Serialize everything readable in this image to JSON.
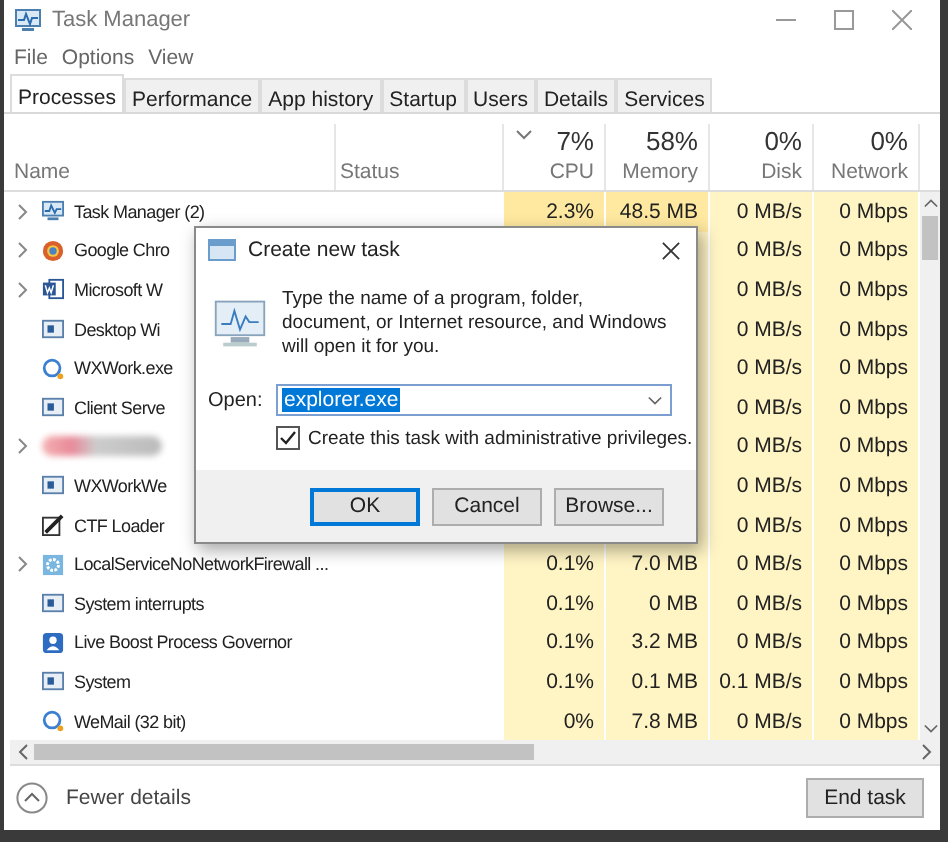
{
  "window": {
    "title": "Task Manager"
  },
  "menu": [
    "File",
    "Options",
    "View"
  ],
  "tabs": [
    {
      "label": "Processes",
      "selected": true
    },
    {
      "label": "Performance",
      "selected": false
    },
    {
      "label": "App history",
      "selected": false
    },
    {
      "label": "Startup",
      "selected": false
    },
    {
      "label": "Users",
      "selected": false
    },
    {
      "label": "Details",
      "selected": false
    },
    {
      "label": "Services",
      "selected": false
    }
  ],
  "columns": [
    {
      "label": "Name",
      "sorted": false
    },
    {
      "label": "Status",
      "sorted": false
    },
    {
      "label": "CPU",
      "total": "7%",
      "sorted": true
    },
    {
      "label": "Memory",
      "total": "58%",
      "sorted": false
    },
    {
      "label": "Disk",
      "total": "0%",
      "sorted": false
    },
    {
      "label": "Network",
      "total": "0%",
      "sorted": false
    }
  ],
  "rows": [
    {
      "kind": "monitor",
      "expandable": true,
      "name": "Task Manager (2)",
      "cpu": "2.3%",
      "memory": "48.5 MB",
      "disk": "0 MB/s",
      "network": "0 Mbps"
    },
    {
      "kind": "browser",
      "expandable": true,
      "name": "Google Chro",
      "disk": "0 MB/s",
      "network": "0 Mbps"
    },
    {
      "kind": "document",
      "expandable": true,
      "name": "Microsoft W",
      "disk": "0 MB/s",
      "network": "0 Mbps"
    },
    {
      "kind": "window",
      "expandable": false,
      "name": "Desktop Wi",
      "disk": "0 MB/s",
      "network": "0 Mbps"
    },
    {
      "kind": "chat",
      "expandable": false,
      "name": "WXWork.exe",
      "disk": "0 MB/s",
      "network": "0 Mbps"
    },
    {
      "kind": "window",
      "expandable": false,
      "name": "Client Serve",
      "disk": "0 MB/s",
      "network": "0 Mbps"
    },
    {
      "kind": "redacted",
      "expandable": true,
      "disk": "0 MB/s",
      "network": "0 Mbps"
    },
    {
      "kind": "window",
      "expandable": false,
      "name": "WXWorkWe",
      "disk": "0 MB/s",
      "network": "0 Mbps"
    },
    {
      "kind": "pen",
      "expandable": false,
      "name": "CTF Loader",
      "disk": "0 MB/s",
      "network": "0 Mbps"
    },
    {
      "kind": "gear",
      "expandable": true,
      "name": "LocalServiceNoNetworkFirewall ...",
      "cpu": "0.1%",
      "memory": "7.0 MB",
      "disk": "0 MB/s",
      "network": "0 Mbps"
    },
    {
      "kind": "window",
      "expandable": false,
      "name": "System interrupts",
      "cpu": "0.1%",
      "memory": "0 MB",
      "disk": "0 MB/s",
      "network": "0 Mbps"
    },
    {
      "kind": "person",
      "expandable": false,
      "name": "Live Boost Process Governor",
      "cpu": "0.1%",
      "memory": "3.2 MB",
      "disk": "0 MB/s",
      "network": "0 Mbps"
    },
    {
      "kind": "window",
      "expandable": false,
      "name": "System",
      "cpu": "0.1%",
      "memory": "0.1 MB",
      "disk": "0.1 MB/s",
      "network": "0 Mbps"
    },
    {
      "kind": "chat",
      "expandable": false,
      "name": "WeMail (32 bit)",
      "cpu": "0%",
      "memory": "7.8 MB",
      "disk": "0 MB/s",
      "network": "0 Mbps"
    }
  ],
  "footer": {
    "toggle": "Fewer details",
    "button": "End task"
  },
  "dialog": {
    "title": "Create new task",
    "message": "Type the name of a program, folder, document, or Internet resource, and Windows will open it for you.",
    "open_label": "Open:",
    "value": "explorer.exe",
    "checkbox": {
      "label": "Create this task with administrative privileges.",
      "checked": true
    },
    "buttons": [
      {
        "label": "OK",
        "default": true
      },
      {
        "label": "Cancel",
        "default": false
      },
      {
        "label": "Browse...",
        "default": false
      }
    ]
  }
}
